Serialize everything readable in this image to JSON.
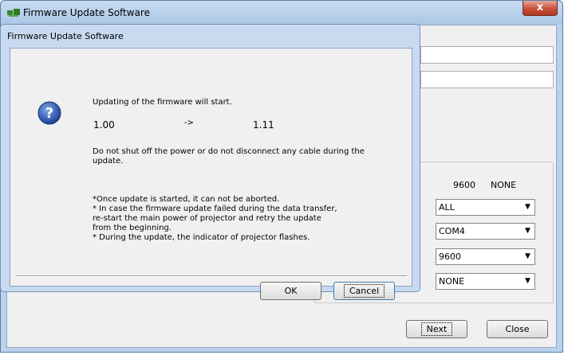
{
  "main_window": {
    "title": "Firmware Update Software",
    "close_label": "x",
    "settings": {
      "baud_label": "9600",
      "parity_label": "NONE",
      "combo_target": "ALL",
      "combo_port": "COM4",
      "combo_baud": "9600",
      "combo_parity": "NONE"
    },
    "buttons": {
      "next": "Next",
      "close": "Close"
    }
  },
  "dialog": {
    "title": "Firmware Update Software",
    "message": "Updating of the firmware will start.",
    "version_from": "1.00",
    "arrow": "->",
    "version_to": "1.11",
    "warning": "Do not shut off the power or do not disconnect any cable during the\nupdate.",
    "notes": "*Once update is started, it can not be aborted.\n* In case the firmware update failed during the data transfer,\nre-start the main power of projector and retry the update\nfrom the beginning.\n* During the update, the indicator of projector flashes.",
    "ok_label": "OK",
    "cancel_label": "Cancel"
  },
  "icons": {
    "dialog_icon": "question-icon",
    "app_icon": "firmware-app-icon"
  }
}
